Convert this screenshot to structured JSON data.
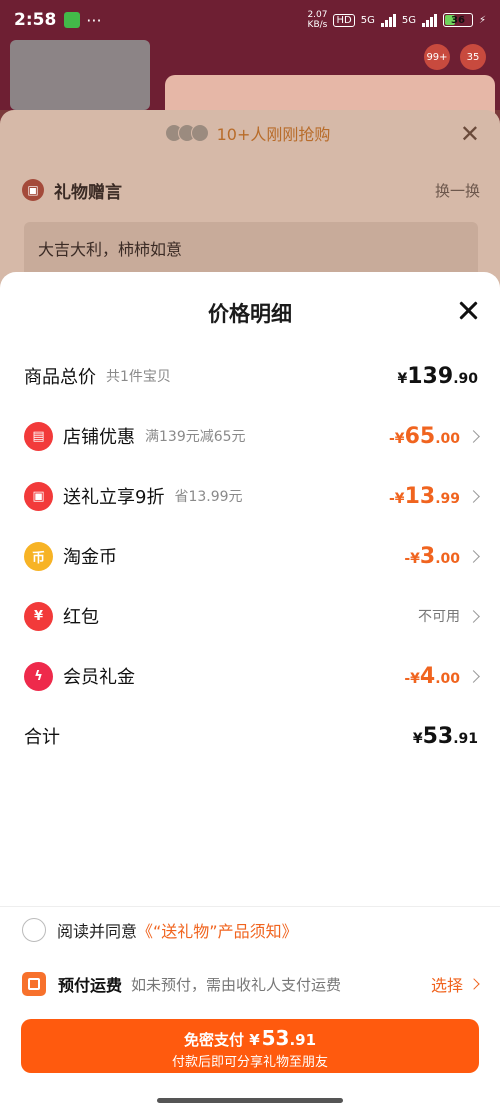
{
  "status_bar": {
    "time": "2:58",
    "net_speed_value": "2.07",
    "net_speed_unit": "KB/s",
    "hd_label": "HD",
    "signal_1": "5G",
    "signal_2": "5G",
    "battery": "36"
  },
  "background": {
    "promo_text": "10+人刚刚抢购",
    "gift_title": "礼物赠言",
    "swap_label": "换一换",
    "message": "大吉大利，柿柿如意",
    "cart_badge": "99+",
    "badge2": "35"
  },
  "sheet": {
    "title": "价格明细",
    "total_row": {
      "label": "商品总价",
      "sub": "共1件宝贝",
      "currency": "¥",
      "int": "139",
      "dec": ".90"
    },
    "discounts": [
      {
        "label": "店铺优惠",
        "sub": "满139元减65元",
        "sign": "-¥",
        "int": "65",
        "dec": ".00",
        "icon": "shop-icon",
        "color": "#f23a3a"
      },
      {
        "label": "送礼立享9折",
        "sub": "省13.99元",
        "sign": "-¥",
        "int": "13",
        "dec": ".99",
        "icon": "gift-icon",
        "color": "#f23a3a"
      },
      {
        "label": "淘金币",
        "sub": "",
        "sign": "-¥",
        "int": "3",
        "dec": ".00",
        "icon": "coin-icon",
        "color": "#f7b325"
      },
      {
        "label": "红包",
        "sub": "",
        "na": "不可用",
        "icon": "red-envelope-icon",
        "color": "#f23a3a"
      },
      {
        "label": "会员礼金",
        "sub": "",
        "sign": "-¥",
        "int": "4",
        "dec": ".00",
        "icon": "lightning-icon",
        "color": "#ee2a4b"
      }
    ],
    "sum_row": {
      "label": "合计",
      "currency": "¥",
      "int": "53",
      "dec": ".91"
    }
  },
  "agreement": {
    "prefix": "阅读并同意",
    "link": "《“送礼物”产品须知》"
  },
  "shipping": {
    "title": "预付运费",
    "desc": "如未预付，需由收礼人支付运费",
    "action": "选择"
  },
  "pay_button": {
    "label": "免密支付",
    "currency": "¥",
    "int": "53",
    "dec": ".91",
    "sub": "付款后即可分享礼物至朋友"
  },
  "colors": {
    "accent": "#f0641f",
    "pay_button": "#ff5a0e"
  }
}
